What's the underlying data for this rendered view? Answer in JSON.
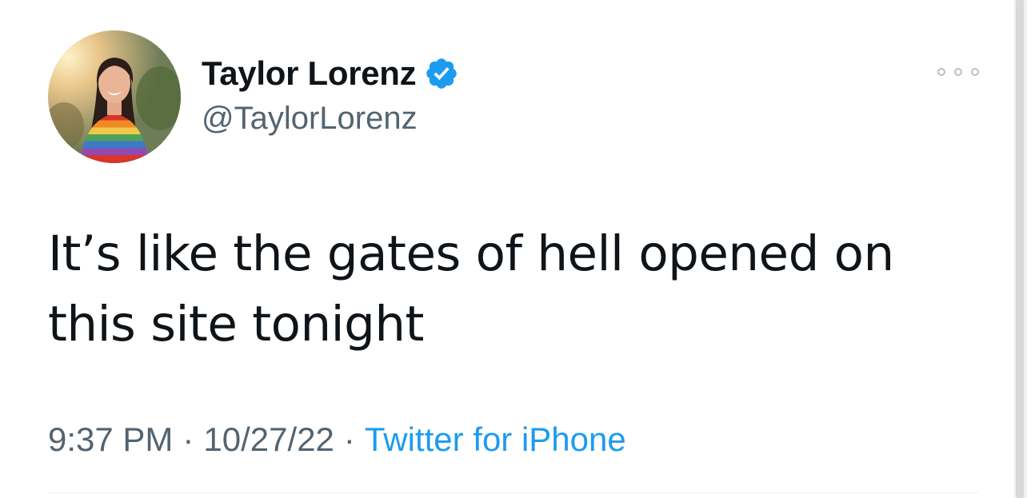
{
  "tweet": {
    "author": {
      "display_name": "Taylor Lorenz",
      "handle": "@TaylorLorenz",
      "verified": true,
      "avatar_icon": "profile-photo",
      "verified_icon": "verified-badge-icon"
    },
    "text": "It’s like the gates of hell opened on this site tonight",
    "time": "9:37 PM",
    "separator": "·",
    "date": "10/27/22",
    "source": "Twitter for iPhone",
    "more_icon": "more-options-icon"
  },
  "colors": {
    "text_primary": "#0f1419",
    "text_secondary": "#536471",
    "accent": "#1d9bf0",
    "divider": "#eff3f4",
    "background": "#ffffff"
  }
}
